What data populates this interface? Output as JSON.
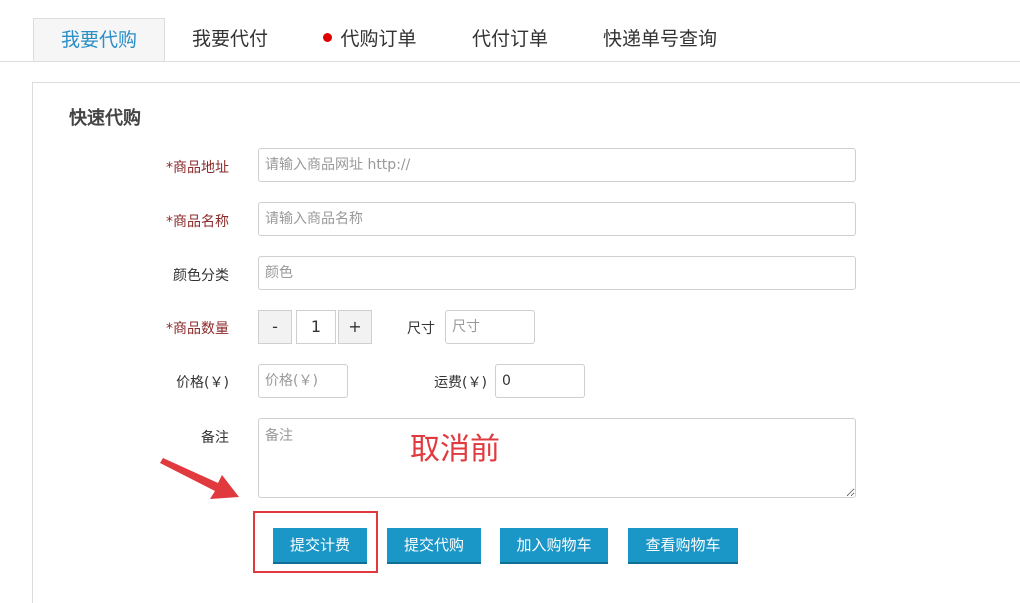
{
  "tabs": [
    {
      "label": "我要代购",
      "active": true
    },
    {
      "label": "我要代付",
      "active": false
    },
    {
      "label": "代购订单",
      "active": false,
      "dot": true
    },
    {
      "label": "代付订单",
      "active": false
    },
    {
      "label": "快递单号查询",
      "active": false
    }
  ],
  "section_title": "快速代购",
  "form": {
    "url_label": "*商品地址",
    "url_placeholder": "请输入商品网址 http://",
    "name_label": "*商品名称",
    "name_placeholder": "请输入商品名称",
    "color_label": "颜色分类",
    "color_placeholder": "颜色",
    "qty_label": "*商品数量",
    "qty_minus": "-",
    "qty_value": "1",
    "qty_plus": "+",
    "size_label": "尺寸",
    "size_placeholder": "尺寸",
    "price_label": "价格(￥)",
    "price_placeholder": "价格(￥)",
    "shipping_label": "运费(￥)",
    "shipping_value": "0",
    "note_label": "备注",
    "note_placeholder": "备注"
  },
  "buttons": {
    "submit_fee": "提交计费",
    "submit_purchase": "提交代购",
    "add_cart": "加入购物车",
    "view_cart": "查看购物车"
  },
  "annotation": {
    "text": "取消前",
    "color": "#e0393e"
  },
  "colors": {
    "accent": "#1a96c7",
    "active_tab_text": "#2a8fc7",
    "required_label": "#8b2a2a"
  }
}
